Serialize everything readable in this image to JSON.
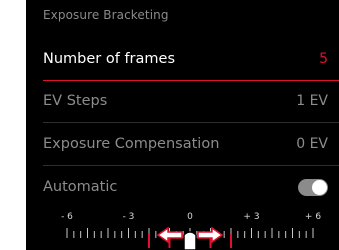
{
  "menu": {
    "title": "Exposure Bracketing",
    "items": [
      {
        "label": "Number of frames",
        "value": "5"
      },
      {
        "label": "EV Steps",
        "value": "1 EV"
      },
      {
        "label": "Exposure Compensation",
        "value": "0 EV"
      },
      {
        "label": "Automatic",
        "toggle": true
      }
    ]
  },
  "scale": {
    "labels": [
      "- 6",
      "- 3",
      "0",
      "+ 3",
      "+ 6"
    ],
    "range": [
      -6,
      6
    ],
    "bracket_ev": [
      -2,
      -1,
      0,
      1,
      2
    ]
  },
  "colors": {
    "accent": "#e0112b",
    "background": "#000000",
    "text_primary": "#ffffff",
    "text_dim": "#8c8c8c"
  }
}
